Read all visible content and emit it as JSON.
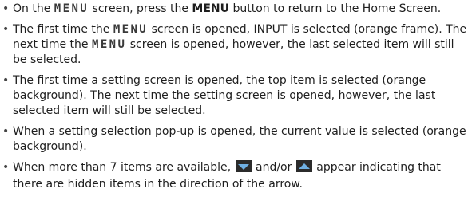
{
  "bullets": [
    {
      "a": "On the ",
      "lcd": "MENU",
      "b": " screen, press the ",
      "bold": "MENU",
      "c": " button to return to the Home Screen."
    },
    {
      "a": "The first time the ",
      "lcd1": "MENU",
      "b": " screen is opened, INPUT is selected (orange frame). The next time the ",
      "lcd2": "MENU",
      "c": " screen is opened, however, the last selected item will still be selected."
    },
    {
      "text": "The first time a setting screen is opened, the top item is selected (orange background). The next time the setting screen is opened, however, the last selected item will still be selected."
    },
    {
      "text": "When a setting selection pop-up is opened, the current value is selected (orange background)."
    },
    {
      "a": "When more than 7 items are available, ",
      "down_icon": "down-arrow-icon",
      "mid": " and/or ",
      "up_icon": "up-arrow-icon",
      "c": " appear indicating that there are hidden items in the direction of the arrow."
    }
  ],
  "colors": {
    "text": "#1e1e1e",
    "icon_bg": "#2b2b2b",
    "icon_arrow": "#6fb0e3"
  }
}
